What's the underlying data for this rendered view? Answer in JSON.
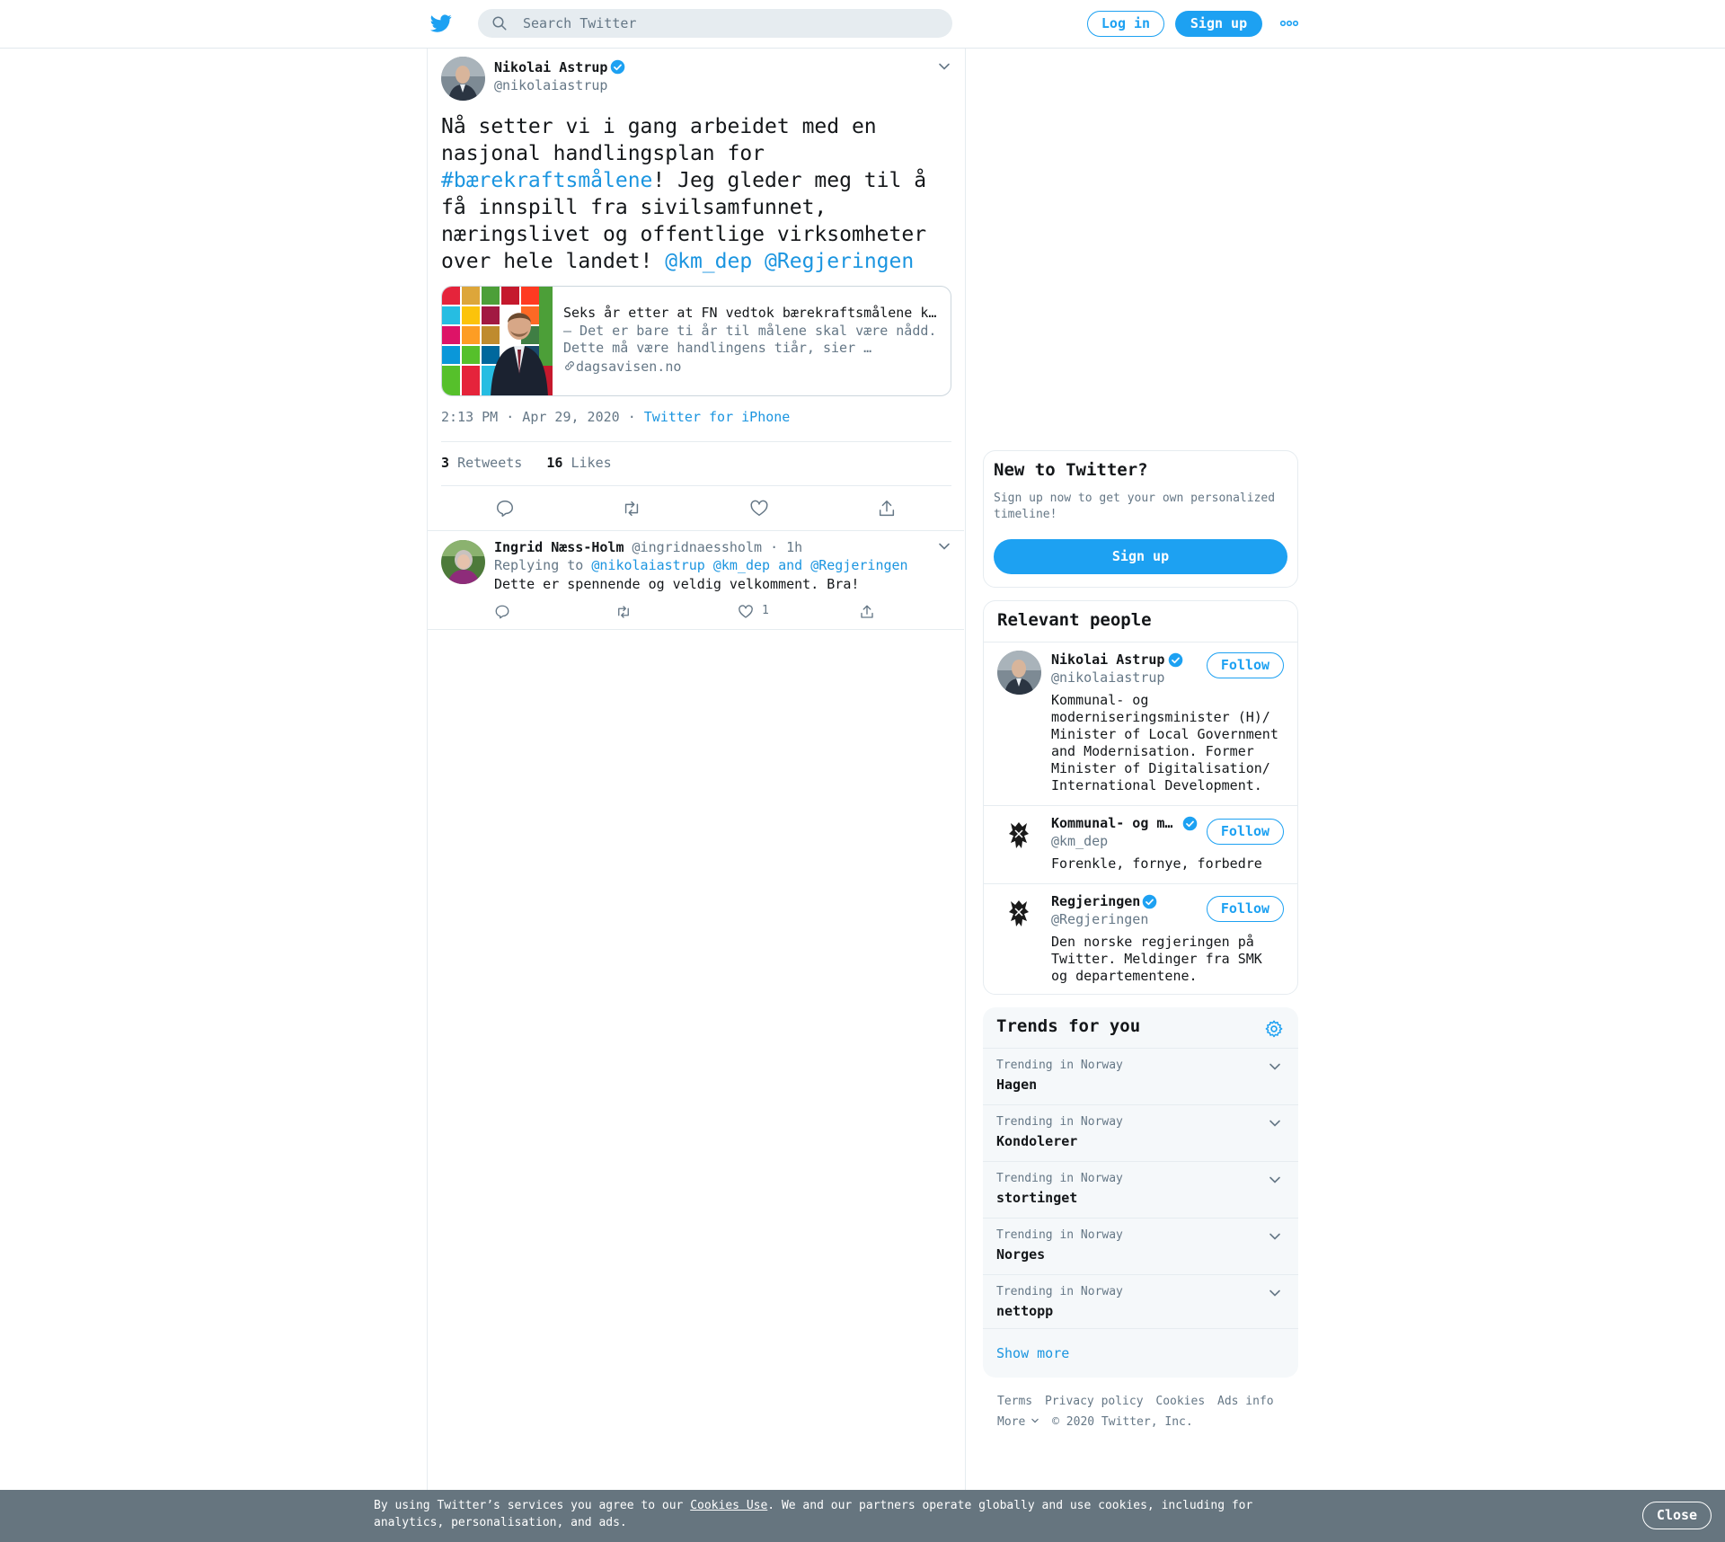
{
  "colors": {
    "brand": "#1da1f2",
    "link": "#1b95e0",
    "muted": "#657786",
    "cookie_bar": "#66757f"
  },
  "header": {
    "logo_icon": "twitter-bird-icon",
    "search_placeholder": "Search Twitter",
    "login_label": "Log in",
    "signup_label": "Sign up",
    "more_icon": "more-dots-icon"
  },
  "tweet": {
    "author_name": "Nikolai Astrup",
    "author_handle": "@nikolaiastrup",
    "text_1": "Nå setter vi i gang arbeidet med en nasjonal handlingsplan for ",
    "hashtag": "#bærekraftsmålene",
    "text_2": "! Jeg gleder meg til å få innspill fra sivilsamfunnet, næringslivet og offentlige virksomheter over hele landet! ",
    "mention_1": "@km_dep",
    "mention_2": "@Regjeringen",
    "card": {
      "title": "Seks år etter at FN vedtok bærekraftsmålene kommer handlingsplanen",
      "description": "– Det er bare ti år til målene skal være nådd. Dette må være handlingens tiår, sier …",
      "domain": "dagsavisen.no"
    },
    "time": "2:13 PM · Apr 29, 2020",
    "source_sep": "·",
    "source": "Twitter for iPhone",
    "retweets_count": "3",
    "retweets_label": "Retweets",
    "likes_count": "16",
    "likes_label": "Likes"
  },
  "reply": {
    "author_name": "Ingrid Næss-Holm",
    "author_handle": "@ingridnaessholm",
    "time": "· 1h",
    "replying_prefix": "Replying to",
    "replying_to": "@nikolaiastrup @km_dep and @Regjeringen",
    "text": "Dette er spennende og veldig velkomment. Bra!",
    "like_count": "1"
  },
  "sidebar": {
    "new_title": "New to Twitter?",
    "new_desc": "Sign up now to get your own personalized timeline!",
    "new_signup": "Sign up",
    "people_title": "Relevant people",
    "follow_label": "Follow",
    "people": [
      {
        "name": "Nikolai Astrup",
        "handle": "@nikolaiastrup",
        "bio": "Kommunal- og moderniseringsminister (H)/ Minister of Local Government and Modernisation. Former Minister of Digitalisation/ International Development."
      },
      {
        "name": "Kommunal- og m…",
        "handle": "@km_dep",
        "bio": "Forenkle, fornye, forbedre"
      },
      {
        "name": "Regjeringen",
        "handle": "@Regjeringen",
        "bio": "Den norske regjeringen på Twitter. Meldinger fra SMK og departementene."
      }
    ],
    "trends_title": "Trends for you",
    "trends": [
      {
        "context": "Trending in Norway",
        "name": "Hagen"
      },
      {
        "context": "Trending in Norway",
        "name": "Kondolerer"
      },
      {
        "context": "Trending in Norway",
        "name": "stortinget"
      },
      {
        "context": "Trending in Norway",
        "name": "Norges"
      },
      {
        "context": "Trending in Norway",
        "name": "nettopp"
      }
    ],
    "show_more": "Show more"
  },
  "footer": {
    "terms": "Terms",
    "privacy": "Privacy policy",
    "cookies": "Cookies",
    "ads": "Ads info",
    "more": "More",
    "copyright": "© 2020 Twitter, Inc."
  },
  "cookie_bar": {
    "text_1": "By using Twitter’s services you agree to our ",
    "link": "Cookies Use",
    "text_2": ". We and our partners operate globally and use cookies, including for analytics, personalisation, and ads.",
    "close": "Close"
  }
}
